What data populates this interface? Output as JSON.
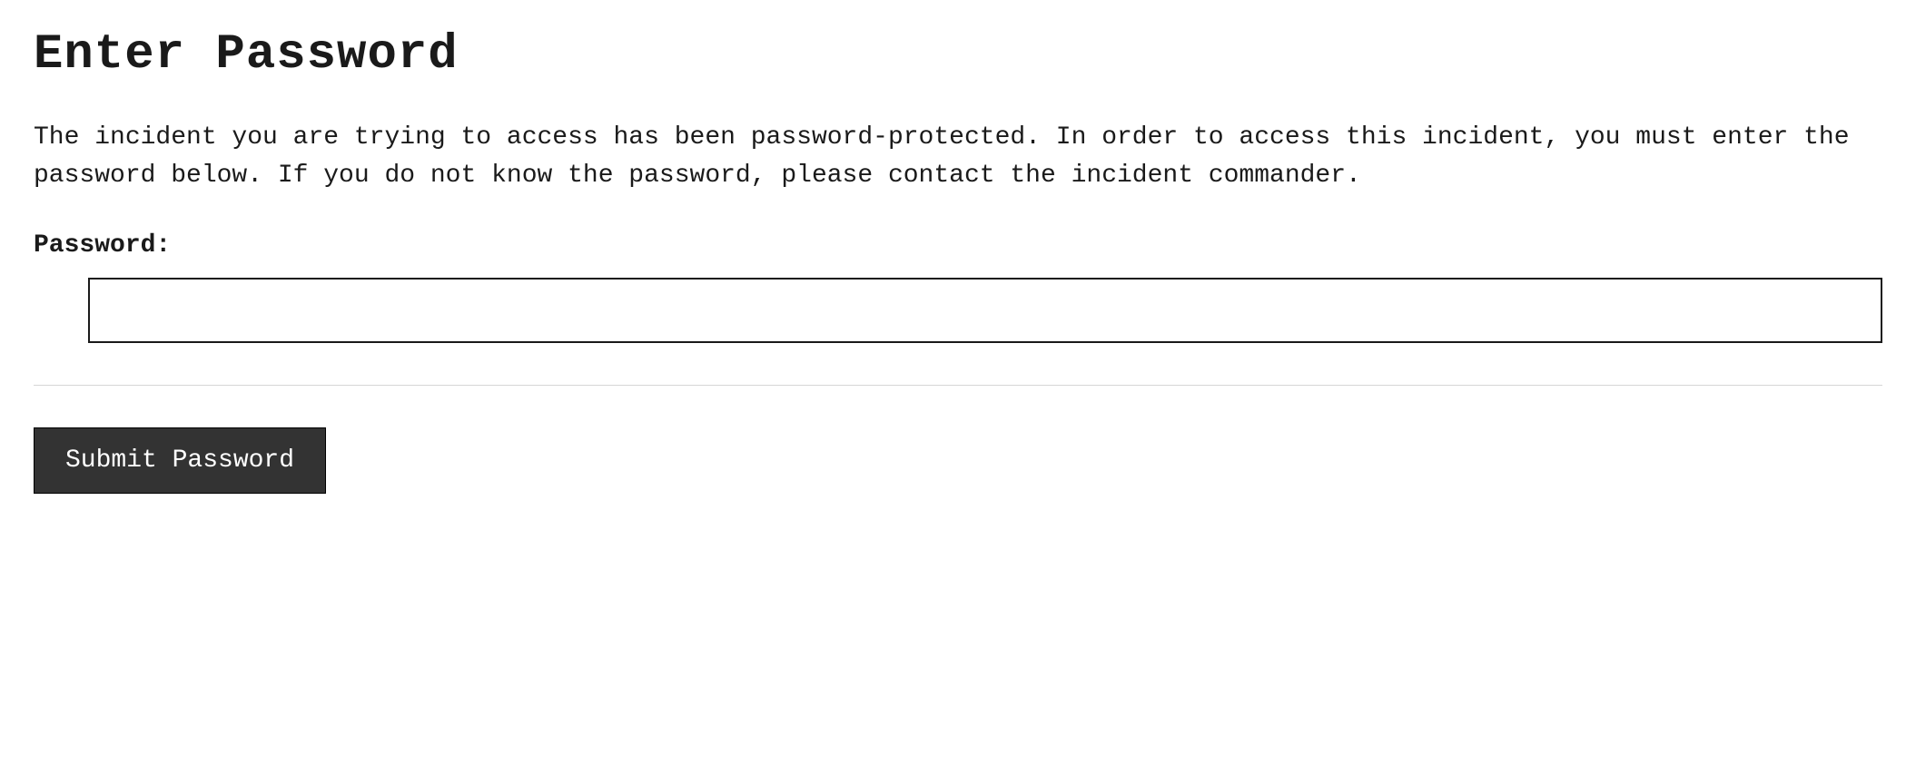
{
  "heading": "Enter Password",
  "description": "The incident you are trying to access has been password-protected. In order to access this incident, you must enter the password below. If you do not know the password, please contact the incident commander.",
  "form": {
    "password_label": "Password:",
    "password_value": "",
    "submit_label": "Submit Password"
  }
}
